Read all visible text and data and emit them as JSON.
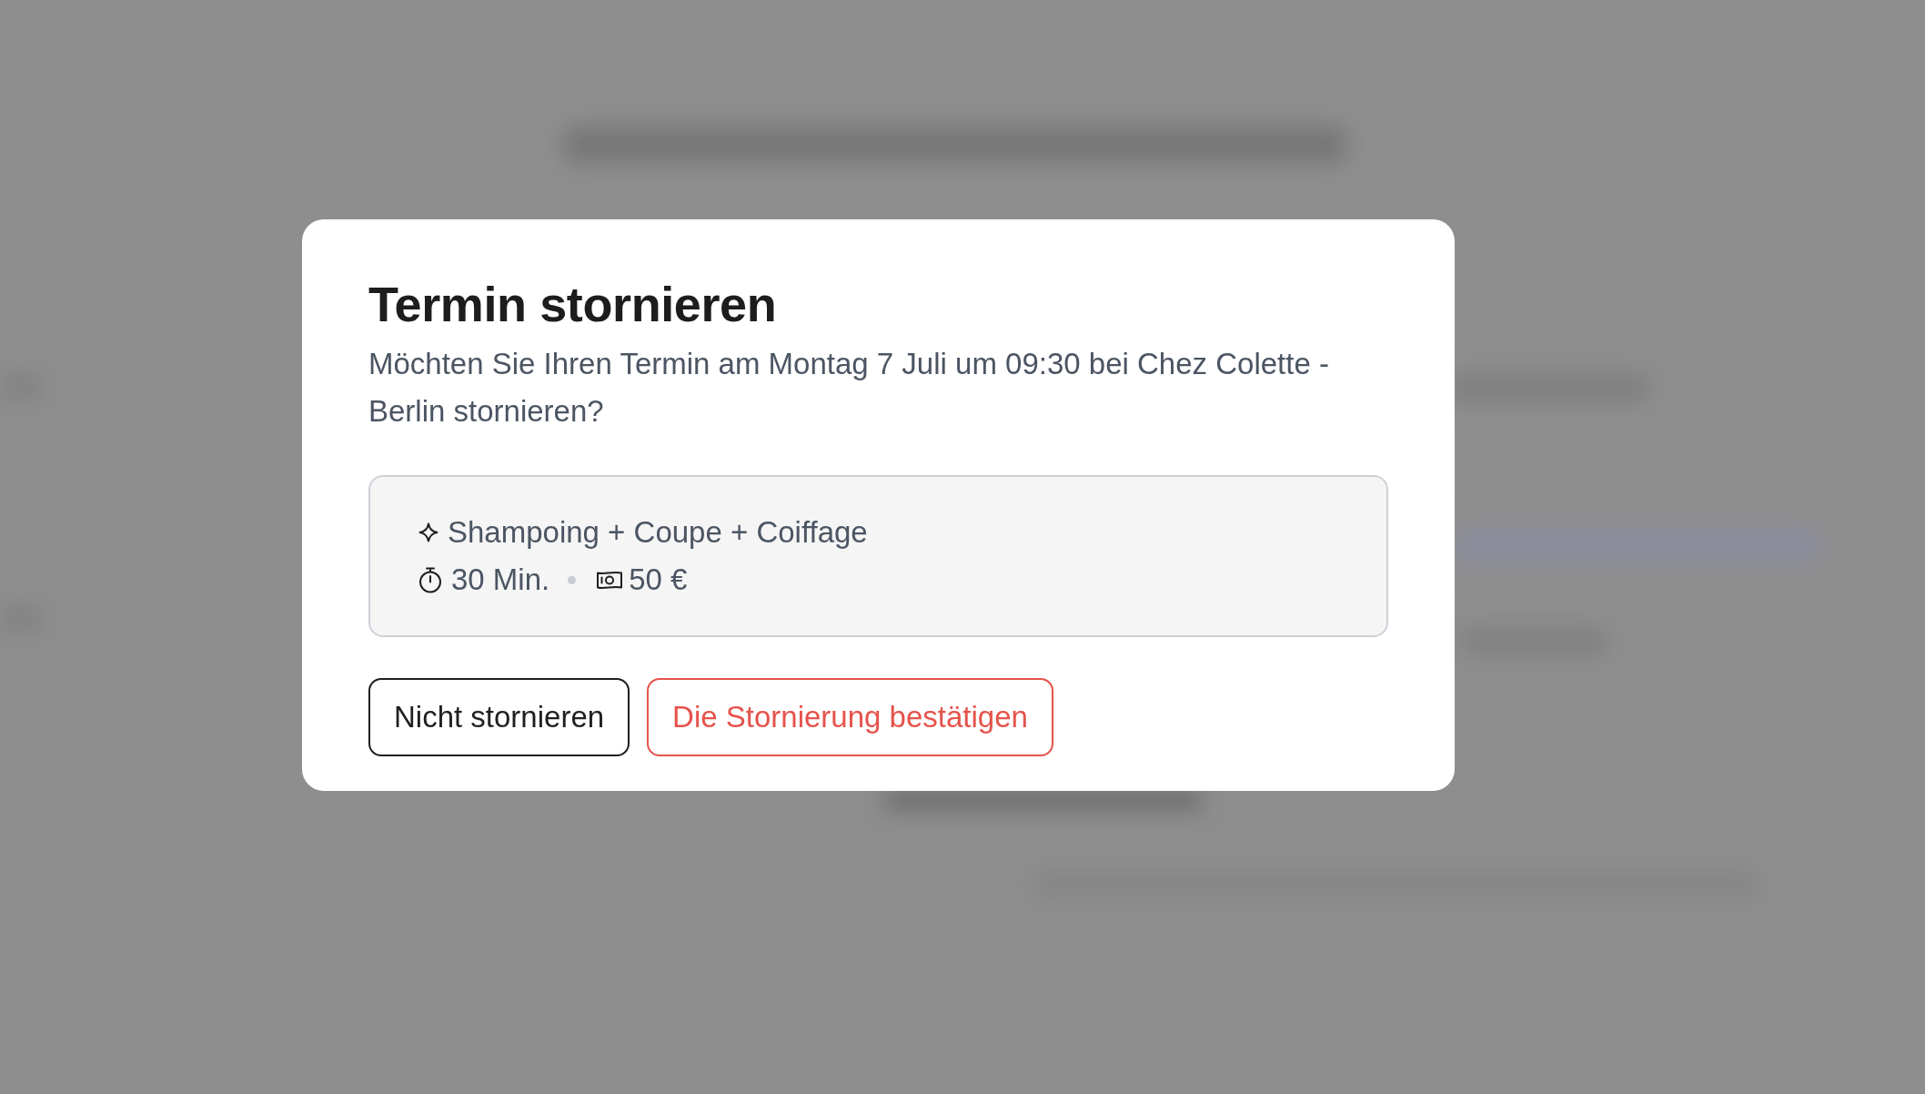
{
  "dialog": {
    "title": "Termin stornieren",
    "message": "Möchten Sie Ihren Termin am Montag 7 Juli um 09:30 bei Chez Colette - Berlin stornieren?",
    "service": {
      "name": "Shampoing + Coupe + Coiffage",
      "duration": "30 Min.",
      "price": "50 €"
    },
    "buttons": [
      {
        "label": "Nicht stornieren",
        "kind": "secondary"
      },
      {
        "label": "Die Stornierung bestätigen",
        "kind": "danger"
      }
    ]
  }
}
